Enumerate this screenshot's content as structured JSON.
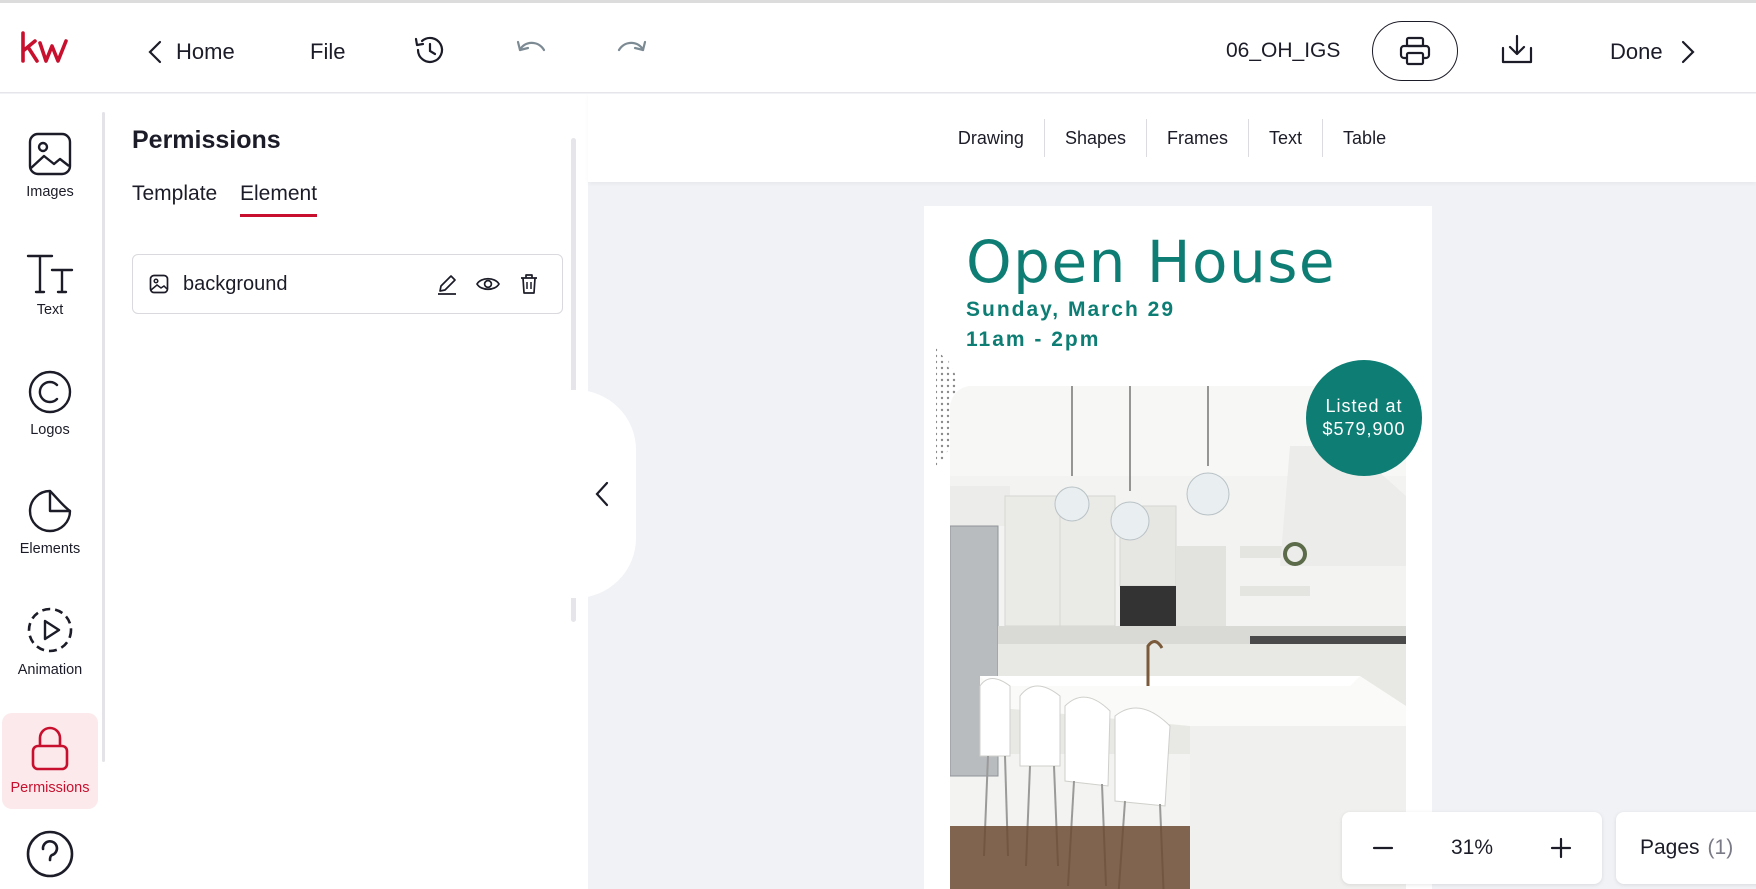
{
  "topbar": {
    "logo_text": "kw",
    "home_label": "Home",
    "file_label": "File",
    "document_name": "06_OH_IGS",
    "done_label": "Done"
  },
  "rail": {
    "items": [
      {
        "label": "Images",
        "icon": "image-icon"
      },
      {
        "label": "Text",
        "icon": "text-icon"
      },
      {
        "label": "Logos",
        "icon": "copyright-icon"
      },
      {
        "label": "Elements",
        "icon": "pie-icon"
      },
      {
        "label": "Animation",
        "icon": "play-circle-icon"
      },
      {
        "label": "Permissions",
        "icon": "lock-icon",
        "active": true
      }
    ]
  },
  "panel": {
    "title": "Permissions",
    "tabs": [
      {
        "label": "Template",
        "active": false
      },
      {
        "label": "Element",
        "active": true
      }
    ],
    "layers": [
      {
        "name": "background",
        "icon": "image-icon"
      }
    ]
  },
  "canvas_toolbar": {
    "tools": [
      "Drawing",
      "Shapes",
      "Frames",
      "Text",
      "Table"
    ]
  },
  "flyer": {
    "title": "Open House",
    "date": "Sunday, March 29",
    "time": "11am - 2pm",
    "badge_line1": "Listed at",
    "badge_line2": "$579,900"
  },
  "zoom": {
    "value": "31%"
  },
  "pages": {
    "label": "Pages",
    "count": "(1)"
  },
  "colors": {
    "brand": "#c8102e",
    "teal": "#0e7d74",
    "canvas_bg": "#f0f2f6"
  }
}
